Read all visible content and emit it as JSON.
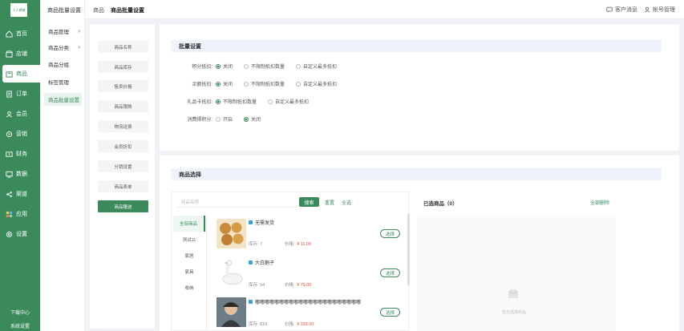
{
  "sidebar": {
    "logo": "人人商城",
    "items": [
      {
        "label": "首页",
        "icon": "home-icon"
      },
      {
        "label": "店铺",
        "icon": "shop-icon"
      },
      {
        "label": "商品",
        "icon": "goods-icon"
      },
      {
        "label": "订单",
        "icon": "order-icon"
      },
      {
        "label": "会员",
        "icon": "member-icon"
      },
      {
        "label": "营销",
        "icon": "marketing-icon"
      },
      {
        "label": "财务",
        "icon": "finance-icon"
      },
      {
        "label": "数据",
        "icon": "data-icon"
      },
      {
        "label": "渠道",
        "icon": "channel-icon"
      },
      {
        "label": "应用",
        "icon": "apps-icon"
      },
      {
        "label": "设置",
        "icon": "settings-icon"
      }
    ],
    "download": "下载中心",
    "system": "系统设置"
  },
  "subnav": {
    "title": "商品批量设置",
    "items": [
      {
        "label": "商品管理"
      },
      {
        "label": "商品分类"
      },
      {
        "label": "商品分组"
      },
      {
        "label": "标签管理"
      },
      {
        "label": "商品批量设置"
      }
    ]
  },
  "header": {
    "crumb1": "商品",
    "crumb2": "商品批量设置",
    "messages": "客户消息",
    "account": "帐号管理"
  },
  "fields": [
    "商品名称",
    "商品库存",
    "售卖价格",
    "商品限购",
    "物流运费",
    "会员折扣",
    "分销设置",
    "商品表单",
    "商品赠送"
  ],
  "batch": {
    "title": "批量设置",
    "rows": [
      {
        "label": "积分抵扣:",
        "options": [
          "关闭",
          "不限制抵扣数量",
          "自定义最多抵扣"
        ]
      },
      {
        "label": "余额抵扣:",
        "options": [
          "关闭",
          "不限制抵扣数量",
          "自定义最多抵扣"
        ]
      },
      {
        "label": "礼品卡抵扣:",
        "options": [
          "不限制抵扣数量",
          "自定义最多抵扣"
        ]
      },
      {
        "label": "消费得积分:",
        "options": [
          "开启",
          "关闭"
        ]
      }
    ]
  },
  "select": {
    "title": "商品选择",
    "search_placeholder": "商品名称",
    "search": "搜索",
    "reset": "重置",
    "select_all": "全选",
    "selected_title": "已选商品（0）",
    "clear_all": "全部删除",
    "empty": "暂无选择商品",
    "categories": [
      "全部商品",
      "测试11",
      "家居",
      "家具",
      "收纳"
    ],
    "products": [
      {
        "name": "无需发货",
        "stock_label": "库存: 7",
        "price_label": "价格:",
        "price": "￥11.00",
        "btn": "选择"
      },
      {
        "name": "大白鹅子",
        "stock_label": "库存: 94",
        "price_label": "价格:",
        "price": "￥79.00",
        "btn": "选择"
      },
      {
        "name": "嘟嘟嘟嘟嘟嘟嘟嘟嘟嘟嘟嘟嘟嘟嘟嘟嘟嘟嘟嘟嘟嘟",
        "stock_label": "库存: 816",
        "price_label": "价格:",
        "price": "￥333.00",
        "btn": "选择"
      }
    ]
  },
  "colors": {
    "brand": "#3a8a5c",
    "price": "#e04a3a"
  }
}
